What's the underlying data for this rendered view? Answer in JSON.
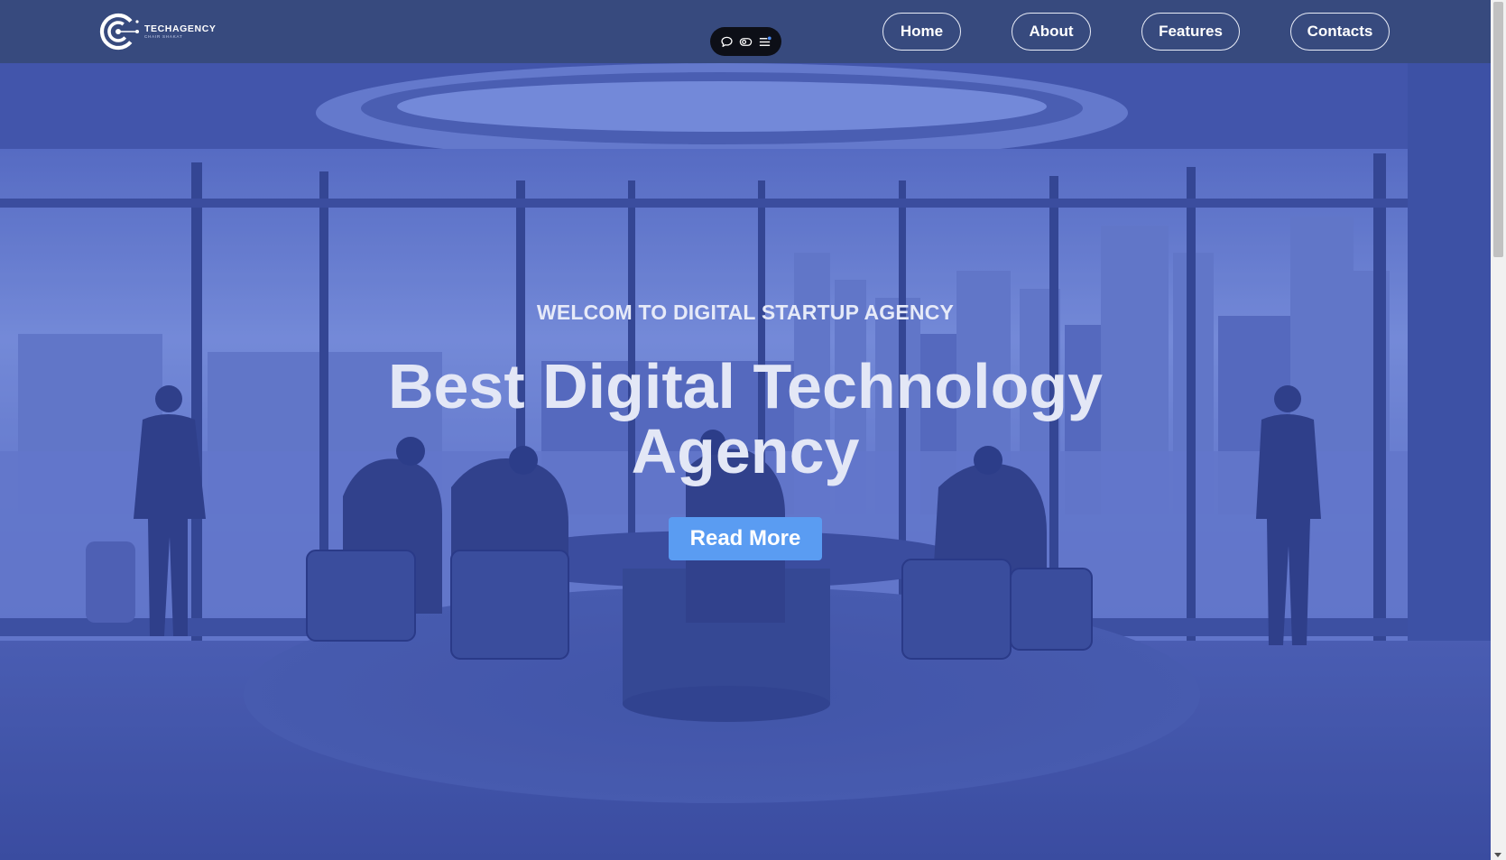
{
  "brand": {
    "name": "TECHAGENCY",
    "tagline": "CHAIR SHAKAT",
    "logo_icon": "circular-c-logo-icon"
  },
  "toolbar": {
    "icons": [
      "chat-bubble-icon",
      "toggle-eye-icon",
      "menu-icon"
    ]
  },
  "nav": {
    "items": [
      {
        "label": "Home"
      },
      {
        "label": "About"
      },
      {
        "label": "Features"
      },
      {
        "label": "Contacts"
      }
    ]
  },
  "hero": {
    "eyebrow": "WELCOM TO DIGITAL STARTUP AGENCY",
    "title_line1": "Best Digital Technology",
    "title_line2": "Agency",
    "cta_label": "Read More"
  },
  "colors": {
    "header_bg": "#374a7e",
    "hero_tint": "#5a6fc4",
    "cta_bg": "#5a9cf2",
    "toolbar_bg": "#0d0f17"
  }
}
